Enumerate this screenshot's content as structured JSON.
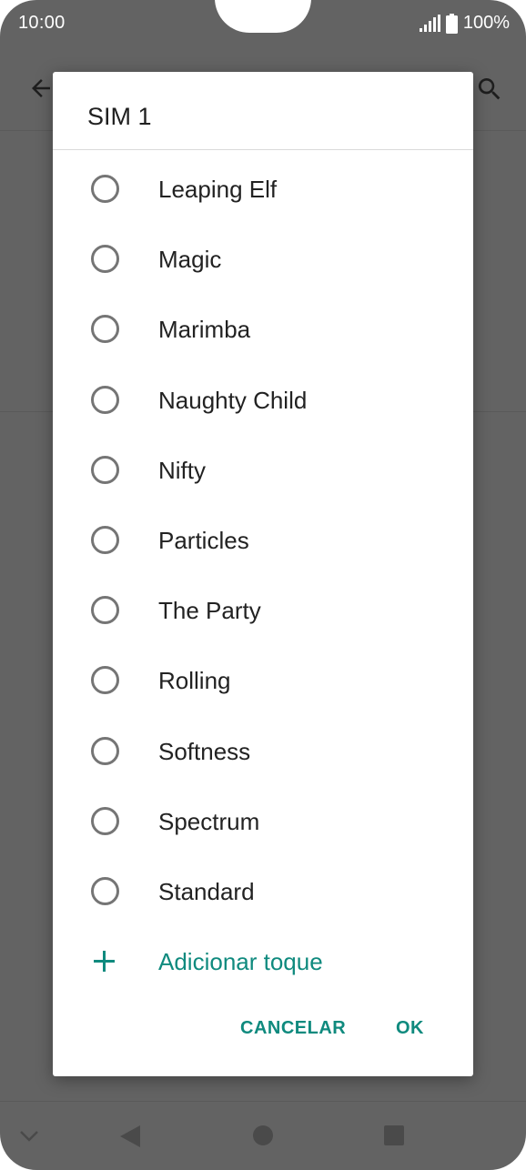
{
  "status_bar": {
    "time": "10:00",
    "battery": "100%"
  },
  "dialog": {
    "title": "SIM 1",
    "options": [
      {
        "label": "Leaping Elf",
        "selected": false
      },
      {
        "label": "Magic",
        "selected": false
      },
      {
        "label": "Marimba",
        "selected": false
      },
      {
        "label": "Naughty Child",
        "selected": false
      },
      {
        "label": "Nifty",
        "selected": false
      },
      {
        "label": "Particles",
        "selected": false
      },
      {
        "label": "The Party",
        "selected": false
      },
      {
        "label": "Rolling",
        "selected": false
      },
      {
        "label": "Softness",
        "selected": false
      },
      {
        "label": "Spectrum",
        "selected": false
      },
      {
        "label": "Standard",
        "selected": false
      }
    ],
    "add_label": "Adicionar toque",
    "cancel_label": "CANCELAR",
    "ok_label": "OK"
  },
  "colors": {
    "accent": "#0f8a7e",
    "scrim": "#636363",
    "radio": "#757575"
  },
  "icons": {
    "back": "arrow-left-icon",
    "search": "search-icon",
    "signal": "signal-icon",
    "battery": "battery-icon",
    "add": "plus-icon",
    "nav_down": "chevron-down-icon",
    "nav_back": "triangle-back-icon",
    "nav_home": "circle-home-icon",
    "nav_recents": "square-recents-icon"
  }
}
